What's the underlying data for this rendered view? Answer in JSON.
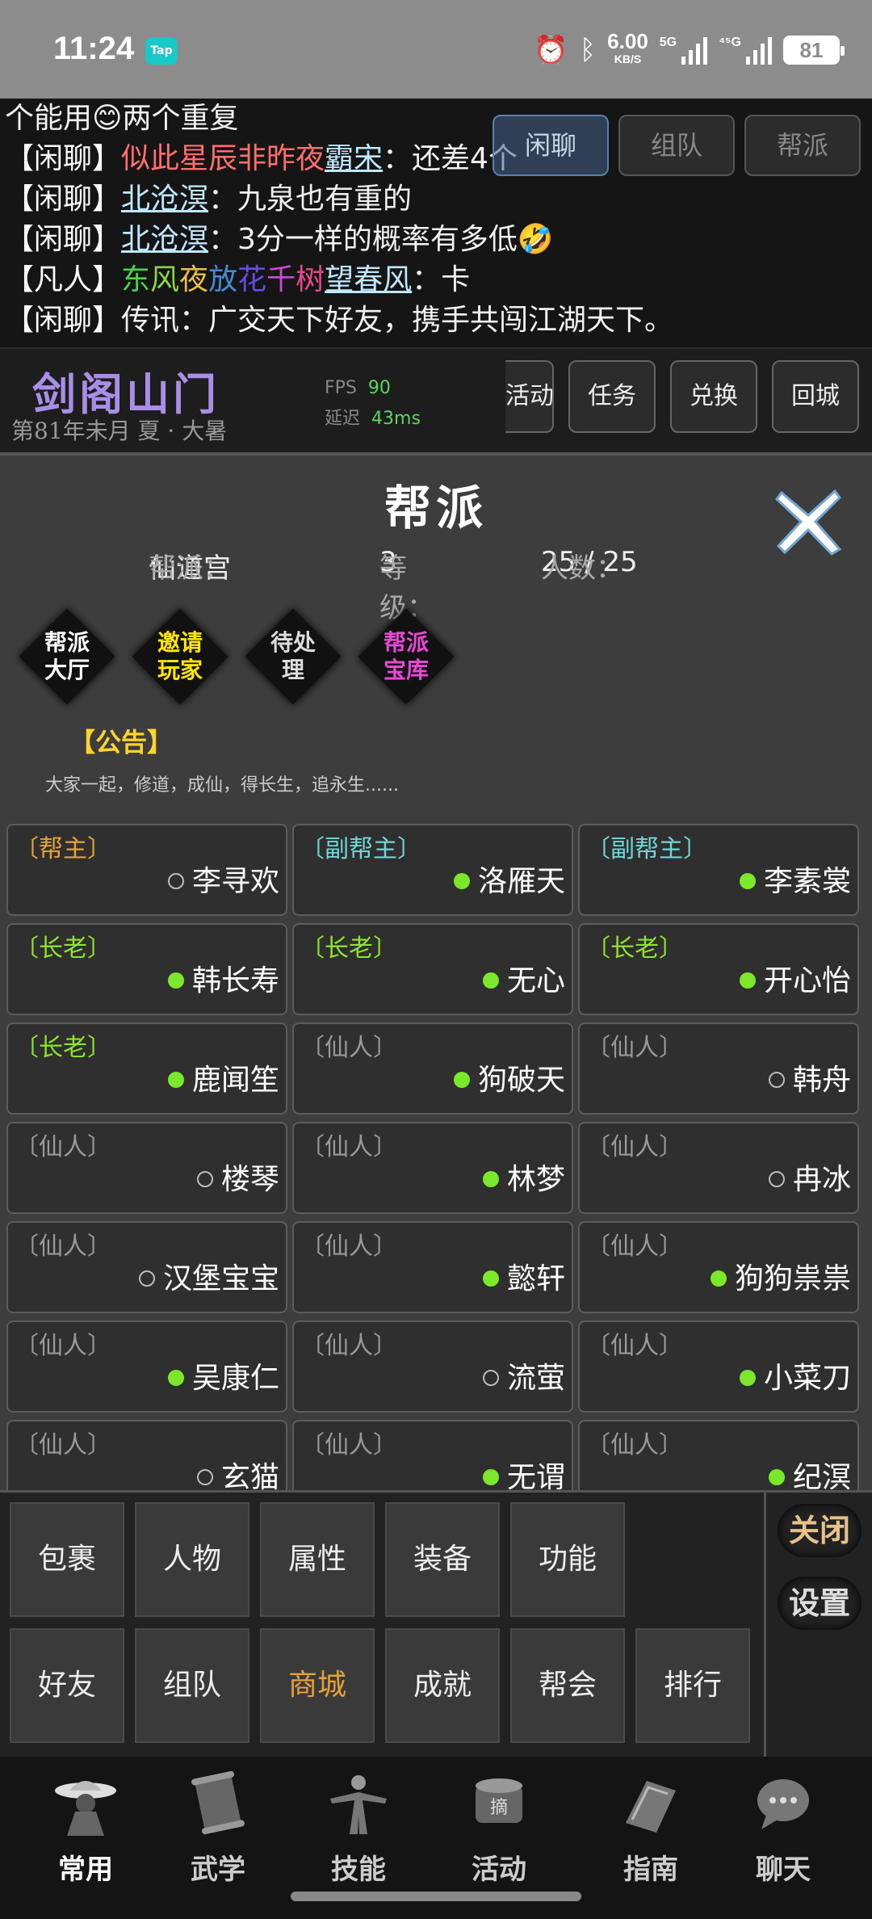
{
  "status": {
    "time": "11:24",
    "tap_label": "Tap",
    "speed": "6.00",
    "speed_unit": "KB/S",
    "net1": "5G",
    "net2": "⁴⁵G",
    "battery": "81"
  },
  "chat": {
    "lines": [
      {
        "tag": "",
        "sender": "",
        "text": "个能用😊两个重复"
      },
      {
        "tag": "【闲聊】",
        "title": "似此星辰非昨夜",
        "sender": "霸宋",
        "text": "：还差4个"
      },
      {
        "tag": "【闲聊】",
        "sender": "北沧溟",
        "text": "：九泉也有重的"
      },
      {
        "tag": "【闲聊】",
        "sender": "北沧溟",
        "text": "：3分一样的概率有多低🤣"
      },
      {
        "tag": "【凡人】",
        "title": "东风夜放花千树",
        "sender": "望春风",
        "text": "：卡"
      },
      {
        "tag": "【闲聊】",
        "sender": "传讯",
        "text": "：广交天下好友，携手共闯江湖天下。"
      }
    ],
    "tabs": [
      "闲聊",
      "组队",
      "帮派"
    ]
  },
  "header": {
    "title": "剑阁山门",
    "date": "第81年未月 夏 · 大暑",
    "fps_label": "FPS",
    "fps_value": "90",
    "latency_label": "延迟",
    "latency_value": "43ms",
    "buttons": [
      "活动",
      "任务",
      "兑换",
      "回城"
    ]
  },
  "panel": {
    "title": "帮派",
    "guild_label": "帮派：",
    "guild_name": "仙道宫",
    "level_label": "等级：",
    "level_value": "3",
    "members_label": "人数：",
    "members_value": "25 / 25",
    "diamonds": [
      {
        "label": "帮派大厅",
        "color": "#ffffff"
      },
      {
        "label": "邀请玩家",
        "color": "#ffe600"
      },
      {
        "label": "待处理",
        "color": "#dddddd"
      },
      {
        "label": "帮派宝库",
        "color": "#e64ad4"
      }
    ],
    "notice_title": "【公告】",
    "notice_text": "大家一起，修道，成仙，得长生，追永生......",
    "members": [
      {
        "role": "〔帮主〕",
        "name": "李寻欢",
        "online": false,
        "role_color": "#e6a23a"
      },
      {
        "role": "〔副帮主〕",
        "name": "洛雁天",
        "online": true,
        "role_color": "#6fd6d6"
      },
      {
        "role": "〔副帮主〕",
        "name": "李素裳",
        "online": true,
        "role_color": "#6fd6d6"
      },
      {
        "role": "〔长老〕",
        "name": "韩长寿",
        "online": true,
        "role_color": "#8ee62a"
      },
      {
        "role": "〔长老〕",
        "name": "无心",
        "online": true,
        "role_color": "#8ee62a"
      },
      {
        "role": "〔长老〕",
        "name": "开心怡",
        "online": true,
        "role_color": "#8ee62a"
      },
      {
        "role": "〔长老〕",
        "name": "鹿闻笙",
        "online": true,
        "role_color": "#8ee62a"
      },
      {
        "role": "〔仙人〕",
        "name": "狗破天",
        "online": true,
        "role_color": "#999999"
      },
      {
        "role": "〔仙人〕",
        "name": "韩舟",
        "online": false,
        "role_color": "#999999"
      },
      {
        "role": "〔仙人〕",
        "name": "楼琴",
        "online": false,
        "role_color": "#999999"
      },
      {
        "role": "〔仙人〕",
        "name": "林梦",
        "online": true,
        "role_color": "#999999"
      },
      {
        "role": "〔仙人〕",
        "name": "冉冰",
        "online": false,
        "role_color": "#999999"
      },
      {
        "role": "〔仙人〕",
        "name": "汉堡宝宝",
        "online": false,
        "role_color": "#999999"
      },
      {
        "role": "〔仙人〕",
        "name": "懿轩",
        "online": true,
        "role_color": "#999999"
      },
      {
        "role": "〔仙人〕",
        "name": "狗狗祟祟",
        "online": true,
        "role_color": "#999999"
      },
      {
        "role": "〔仙人〕",
        "name": "吴康仁",
        "online": true,
        "role_color": "#999999"
      },
      {
        "role": "〔仙人〕",
        "name": "流萤",
        "online": false,
        "role_color": "#999999"
      },
      {
        "role": "〔仙人〕",
        "name": "小菜刀",
        "online": true,
        "role_color": "#999999"
      },
      {
        "role": "〔仙人〕",
        "name": "玄猫",
        "online": false,
        "role_color": "#999999"
      },
      {
        "role": "〔仙人〕",
        "name": "无谓",
        "online": true,
        "role_color": "#999999"
      },
      {
        "role": "〔仙人〕",
        "name": "纪溟",
        "online": true,
        "role_color": "#999999"
      }
    ]
  },
  "menu": {
    "row1": [
      "包裹",
      "人物",
      "属性",
      "装备",
      "功能"
    ],
    "row2": [
      "好友",
      "组队",
      "商城",
      "成就",
      "帮会",
      "排行"
    ],
    "highlight": "商城",
    "side": [
      {
        "label": "关闭",
        "color": "#e6c28a"
      },
      {
        "label": "设置",
        "color": "#dddddd"
      }
    ]
  },
  "nav": {
    "items": [
      "常用",
      "武学",
      "技能",
      "活动",
      "指南",
      "聊天"
    ],
    "active": "常用"
  }
}
